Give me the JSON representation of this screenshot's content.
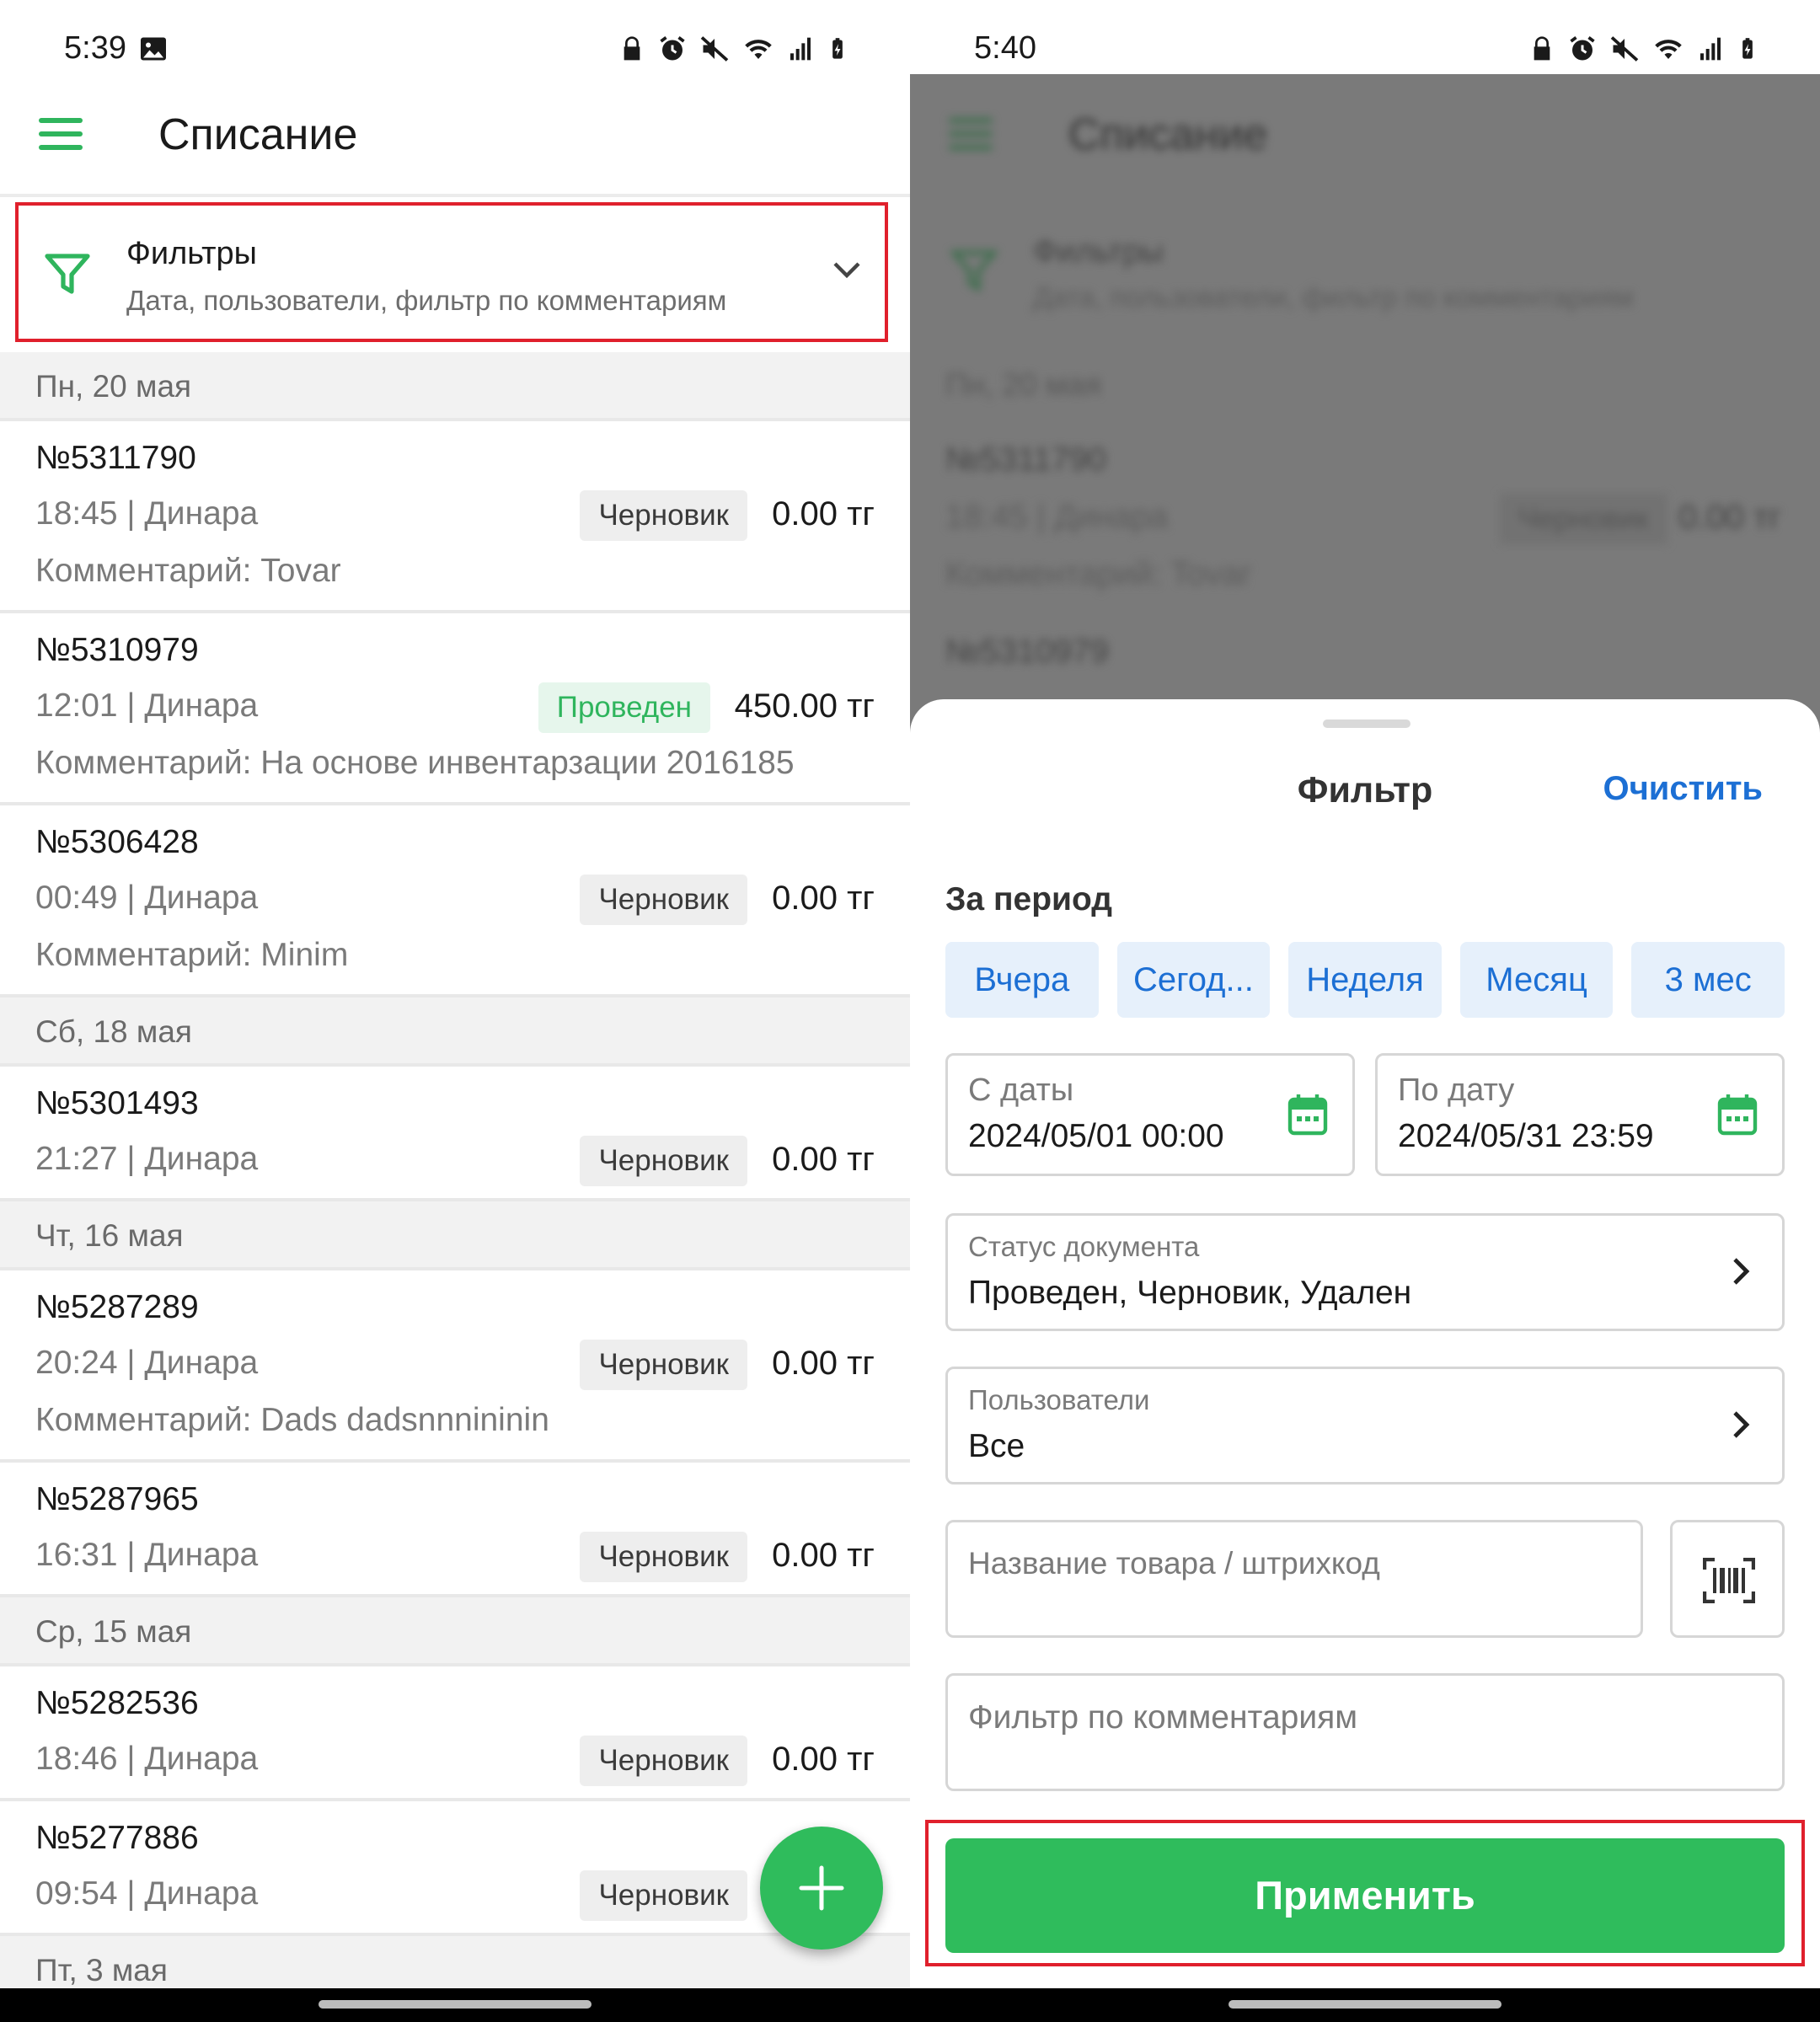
{
  "left_screen": {
    "status": {
      "time": "5:39"
    },
    "appbar": {
      "title": "Списание"
    },
    "filters": {
      "title": "Фильтры",
      "subtitle": "Дата, пользователи, фильтр по комментариям"
    },
    "days": [
      {
        "label": "Пн, 20 мая",
        "docs": [
          {
            "number": "№5311790",
            "meta": "18:45 | Динара",
            "status": "Черновик",
            "amount": "0.00 тг",
            "comment": "Комментарий:  Tovar"
          },
          {
            "number": "№5310979",
            "meta": "12:01 | Динара",
            "status": "Проведен",
            "amount": "450.00 тг",
            "comment": "Комментарий:  На основе инвентарзации 2016185"
          },
          {
            "number": "№5306428",
            "meta": "00:49 | Динара",
            "status": "Черновик",
            "amount": "0.00 тг",
            "comment": "Комментарий:  Minim"
          }
        ]
      },
      {
        "label": "Сб, 18 мая",
        "docs": [
          {
            "number": "№5301493",
            "meta": "21:27 | Динара",
            "status": "Черновик",
            "amount": "0.00 тг"
          }
        ]
      },
      {
        "label": "Чт, 16 мая",
        "docs": [
          {
            "number": "№5287289",
            "meta": "20:24 | Динара",
            "status": "Черновик",
            "amount": "0.00 тг",
            "comment": "Комментарий:  Dads dadsnnnininin"
          },
          {
            "number": "№5287965",
            "meta": "16:31 | Динара",
            "status": "Черновик",
            "amount": "0.00 тг"
          }
        ]
      },
      {
        "label": "Ср, 15 мая",
        "docs": [
          {
            "number": "№5282536",
            "meta": "18:46 | Динара",
            "status": "Черновик",
            "amount": "0.00 тг"
          },
          {
            "number": "№5277886",
            "meta": "09:54 | Динара",
            "status": "Черновик",
            "amount": ""
          }
        ]
      },
      {
        "label": "Пт, 3 мая",
        "docs": []
      }
    ],
    "fab_label": "+"
  },
  "right_screen": {
    "status": {
      "time": "5:40"
    },
    "background": {
      "title": "Списание",
      "filters_title": "Фильтры",
      "filters_subtitle": "Дата, пользователи, фильтр по комментариям",
      "day": "Пн, 20 мая",
      "doc1_number": "№5311790",
      "doc1_meta": "18:45 | Динара",
      "doc1_status": "Черновик",
      "doc1_amount": "0.00 тг",
      "doc1_comment": "Комментарий:  Tovar",
      "doc2_number": "№5310979"
    },
    "sheet": {
      "title": "Фильтр",
      "clear": "Очистить",
      "period_label": "За период",
      "chips": [
        "Вчера",
        "Сегод...",
        "Неделя",
        "Месяц",
        "3 мес"
      ],
      "date_from": {
        "label": "С даты",
        "value": "2024/05/01 00:00"
      },
      "date_to": {
        "label": "По дату",
        "value": "2024/05/31 23:59"
      },
      "status_field": {
        "label": "Статус документа",
        "value": "Проведен, Черновик, Удален"
      },
      "users_field": {
        "label": "Пользователи",
        "value": "Все"
      },
      "product_placeholder": "Название товара / штрихкод",
      "comment_placeholder": "Фильтр по комментариям",
      "apply": "Применить"
    }
  },
  "colors": {
    "accent_green": "#2fbc5c",
    "link_blue": "#1c6fd4",
    "highlight_red": "#e0202c",
    "chip_bg": "#e6f0fb"
  }
}
